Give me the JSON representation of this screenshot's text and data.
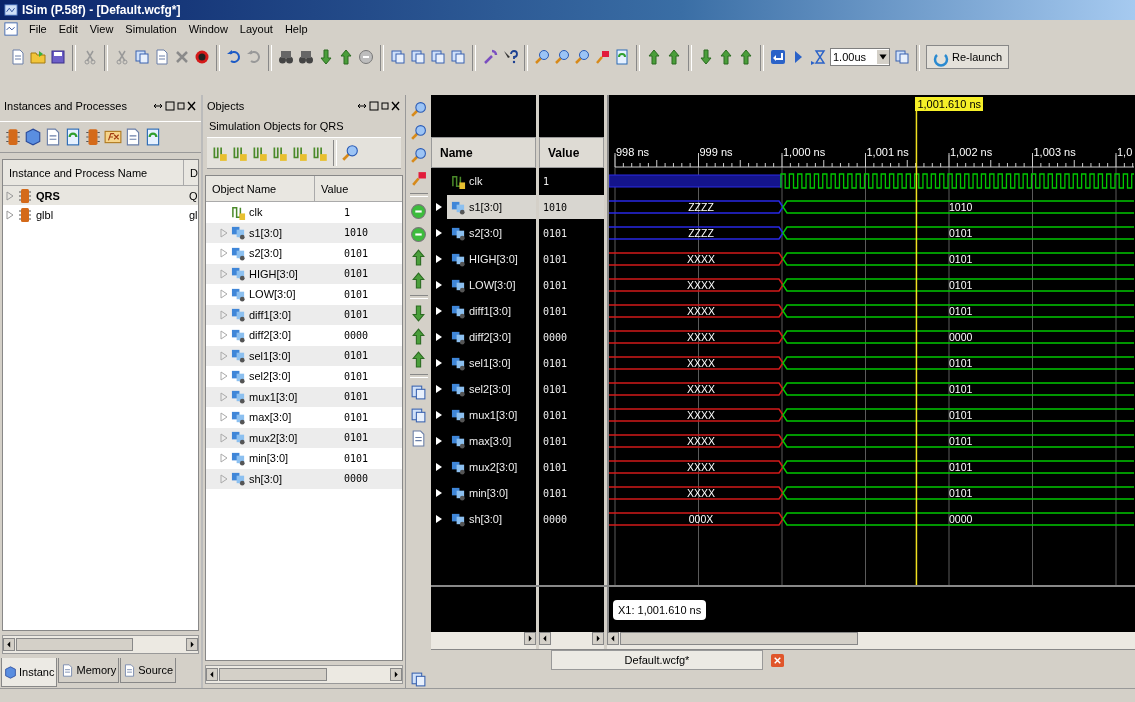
{
  "window": {
    "title": "ISim (P.58f) - [Default.wcfg*]"
  },
  "menu": [
    "File",
    "Edit",
    "View",
    "Simulation",
    "Window",
    "Layout",
    "Help"
  ],
  "toolbar": {
    "run_time": "1.00us",
    "relaunch": "Re-launch"
  },
  "instances_panel": {
    "title": "Instances and Processes",
    "columns": [
      "Instance and Process Name",
      "D"
    ],
    "rows": [
      {
        "name": "QRS",
        "column_2": "Q",
        "selected": true
      },
      {
        "name": "glbl",
        "column_2": "gl",
        "selected": false
      }
    ],
    "tabs": [
      {
        "label": "Instanc",
        "selected": true
      },
      {
        "label": "Memory",
        "selected": false
      },
      {
        "label": "Source",
        "selected": false
      }
    ]
  },
  "objects_panel": {
    "title": "Objects",
    "subtitle": "Simulation Objects for QRS",
    "columns": [
      "Object Name",
      "Value"
    ],
    "rows": [
      {
        "name": "clk",
        "value": "1",
        "kind": "clock"
      },
      {
        "name": "s1[3:0]",
        "value": "1010",
        "kind": "bus"
      },
      {
        "name": "s2[3:0]",
        "value": "0101",
        "kind": "bus"
      },
      {
        "name": "HIGH[3:0]",
        "value": "0101",
        "kind": "bus"
      },
      {
        "name": "LOW[3:0]",
        "value": "0101",
        "kind": "bus"
      },
      {
        "name": "diff1[3:0]",
        "value": "0101",
        "kind": "bus"
      },
      {
        "name": "diff2[3:0]",
        "value": "0000",
        "kind": "bus"
      },
      {
        "name": "sel1[3:0]",
        "value": "0101",
        "kind": "bus"
      },
      {
        "name": "sel2[3:0]",
        "value": "0101",
        "kind": "bus"
      },
      {
        "name": "mux1[3:0]",
        "value": "0101",
        "kind": "bus"
      },
      {
        "name": "max[3:0]",
        "value": "0101",
        "kind": "bus"
      },
      {
        "name": "mux2[3:0]",
        "value": "0101",
        "kind": "bus"
      },
      {
        "name": "min[3:0]",
        "value": "0101",
        "kind": "bus"
      },
      {
        "name": "sh[3:0]",
        "value": "0000",
        "kind": "bus"
      }
    ]
  },
  "waveform": {
    "columns": [
      "Name",
      "Value"
    ],
    "cursor": "1,001.610 ns",
    "cursor_readout": "X1: 1,001.610 ns",
    "ruler": [
      "998 ns",
      "999 ns",
      "1,000 ns",
      "1,001 ns",
      "1,002 ns",
      "1,003 ns",
      "1,0"
    ],
    "signals": [
      {
        "name": "clk",
        "value": "1",
        "kind": "clock",
        "selected": false,
        "segments": [
          {
            "color": "#14148c"
          },
          {
            "color": "#00c800"
          }
        ]
      },
      {
        "name": "s1[3:0]",
        "value": "1010",
        "kind": "bus",
        "selected": true,
        "segments": [
          {
            "label": "ZZZZ",
            "color": "#2828e6"
          },
          {
            "label": "1010",
            "color": "#00c800"
          }
        ]
      },
      {
        "name": "s2[3:0]",
        "value": "0101",
        "kind": "bus",
        "selected": false,
        "segments": [
          {
            "label": "ZZZZ",
            "color": "#2828e6"
          },
          {
            "label": "0101",
            "color": "#00c800"
          }
        ]
      },
      {
        "name": "HIGH[3:0]",
        "value": "0101",
        "kind": "bus",
        "selected": false,
        "segments": [
          {
            "label": "XXXX",
            "color": "#d21a1a"
          },
          {
            "label": "0101",
            "color": "#00c800"
          }
        ]
      },
      {
        "name": "LOW[3:0]",
        "value": "0101",
        "kind": "bus",
        "selected": false,
        "segments": [
          {
            "label": "XXXX",
            "color": "#d21a1a"
          },
          {
            "label": "0101",
            "color": "#00c800"
          }
        ]
      },
      {
        "name": "diff1[3:0]",
        "value": "0101",
        "kind": "bus",
        "selected": false,
        "segments": [
          {
            "label": "XXXX",
            "color": "#d21a1a"
          },
          {
            "label": "0101",
            "color": "#00c800"
          }
        ]
      },
      {
        "name": "diff2[3:0]",
        "value": "0000",
        "kind": "bus",
        "selected": false,
        "segments": [
          {
            "label": "XXXX",
            "color": "#d21a1a"
          },
          {
            "label": "0000",
            "color": "#00c800"
          }
        ]
      },
      {
        "name": "sel1[3:0]",
        "value": "0101",
        "kind": "bus",
        "selected": false,
        "segments": [
          {
            "label": "XXXX",
            "color": "#d21a1a"
          },
          {
            "label": "0101",
            "color": "#00c800"
          }
        ]
      },
      {
        "name": "sel2[3:0]",
        "value": "0101",
        "kind": "bus",
        "selected": false,
        "segments": [
          {
            "label": "XXXX",
            "color": "#d21a1a"
          },
          {
            "label": "0101",
            "color": "#00c800"
          }
        ]
      },
      {
        "name": "mux1[3:0]",
        "value": "0101",
        "kind": "bus",
        "selected": false,
        "segments": [
          {
            "label": "XXXX",
            "color": "#d21a1a"
          },
          {
            "label": "0101",
            "color": "#00c800"
          }
        ]
      },
      {
        "name": "max[3:0]",
        "value": "0101",
        "kind": "bus",
        "selected": false,
        "segments": [
          {
            "label": "XXXX",
            "color": "#d21a1a"
          },
          {
            "label": "0101",
            "color": "#00c800"
          }
        ]
      },
      {
        "name": "mux2[3:0]",
        "value": "0101",
        "kind": "bus",
        "selected": false,
        "segments": [
          {
            "label": "XXXX",
            "color": "#d21a1a"
          },
          {
            "label": "0101",
            "color": "#00c800"
          }
        ]
      },
      {
        "name": "min[3:0]",
        "value": "0101",
        "kind": "bus",
        "selected": false,
        "segments": [
          {
            "label": "XXXX",
            "color": "#d21a1a"
          },
          {
            "label": "0101",
            "color": "#00c800"
          }
        ]
      },
      {
        "name": "sh[3:0]",
        "value": "0000",
        "kind": "bus",
        "selected": false,
        "segments": [
          {
            "label": "000X",
            "color": "#d21a1a"
          },
          {
            "label": "0000",
            "color": "#00c800"
          }
        ]
      }
    ],
    "tab": {
      "label": "Default.wcfg*"
    }
  }
}
